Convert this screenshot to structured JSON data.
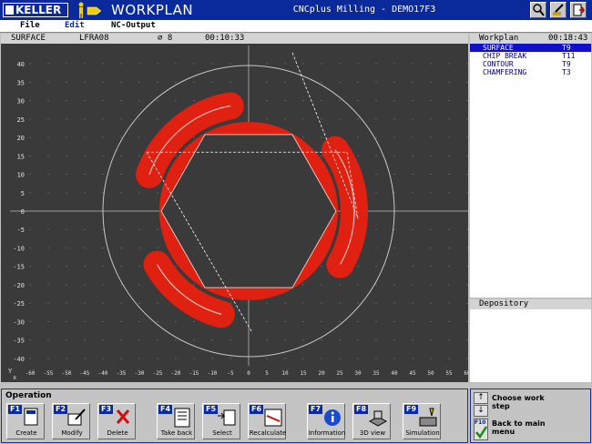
{
  "titlebar": {
    "logo_text": "KELLER",
    "app_title": "WORKPLAN",
    "window_title": "CNCplus Milling - DEMO17F3",
    "buttons": [
      "zoom-icon",
      "pen-icon",
      "exit-icon"
    ]
  },
  "menu": {
    "file": "File",
    "edit": "Edit",
    "nc_output": "NC-Output"
  },
  "viewport": {
    "operation": "SURFACE",
    "program": "LFRA08",
    "diameter": "⌀ 8",
    "time": "00:10:33"
  },
  "plot": {
    "x_ticks": [
      "-60",
      "-55",
      "-50",
      "-45",
      "-40",
      "-35",
      "-30",
      "-25",
      "-20",
      "-15",
      "-10",
      "-5",
      "0",
      "5",
      "10",
      "15",
      "20",
      "25",
      "30",
      "35",
      "40",
      "45",
      "50",
      "55",
      "60"
    ],
    "y_ticks": [
      "40",
      "35",
      "30",
      "25",
      "20",
      "15",
      "10",
      "5",
      "0",
      "-5",
      "-10",
      "-15",
      "-20",
      "-25",
      "-30",
      "-35",
      "-40"
    ],
    "axis_x_label": "x",
    "axis_y_label": "Y",
    "xlim": [
      -60,
      60
    ],
    "ylim": [
      -42,
      42
    ],
    "circle_radius": 40,
    "hexagon_circumradius": 24,
    "pocket_color": "#e02010",
    "background_color": "#3a3a3a",
    "arc_paths": [
      {
        "cx": 0,
        "cy": 0,
        "r": 29,
        "a1": 160,
        "a2": 100
      },
      {
        "cx": 0,
        "cy": 0,
        "r": 29,
        "a1": 35,
        "a2": -30
      },
      {
        "cx": 0,
        "cy": 0,
        "r": 29,
        "a1": -105,
        "a2": -150
      }
    ],
    "rapid_moves": [
      [
        [
          -28,
          16
        ],
        [
          27,
          16
        ]
      ],
      [
        [
          27,
          16
        ],
        [
          30,
          -2
        ]
      ],
      [
        [
          -28,
          16
        ],
        [
          1,
          -33
        ]
      ],
      [
        [
          12,
          43
        ],
        [
          30,
          -2
        ]
      ]
    ]
  },
  "workplan": {
    "title": "Workplan",
    "time": "00:18:43",
    "rows": [
      {
        "name": "SURFACE",
        "tool": "T9"
      },
      {
        "name": "CHIP BREAK",
        "tool": "T11"
      },
      {
        "name": "CONTOUR",
        "tool": "T9"
      },
      {
        "name": "CHAMFERING",
        "tool": "T3"
      }
    ]
  },
  "depository": {
    "title": "Depository"
  },
  "operation": {
    "title": "Operation",
    "buttons": [
      {
        "key": "F1",
        "label": "Create",
        "icon": "create-icon"
      },
      {
        "key": "F2",
        "label": "Modify",
        "icon": "modify-icon"
      },
      {
        "key": "F3",
        "label": "Delete",
        "icon": "delete-icon"
      },
      {
        "key": "F4",
        "label": "Take back",
        "icon": "take-back-icon"
      },
      {
        "key": "F5",
        "label": "Select",
        "icon": "select-icon"
      },
      {
        "key": "F6",
        "label": "Recalculate",
        "icon": "recalculate-icon"
      },
      {
        "key": "F7",
        "label": "Information",
        "icon": "information-icon"
      },
      {
        "key": "F8",
        "label": "3D view",
        "icon": "3d-view-icon"
      },
      {
        "key": "F9",
        "label": "Simulation",
        "icon": "simulation-icon"
      }
    ]
  },
  "nav": {
    "choose_label": "Choose work step",
    "back_key": "F10",
    "back_label": "Back to main menu"
  }
}
